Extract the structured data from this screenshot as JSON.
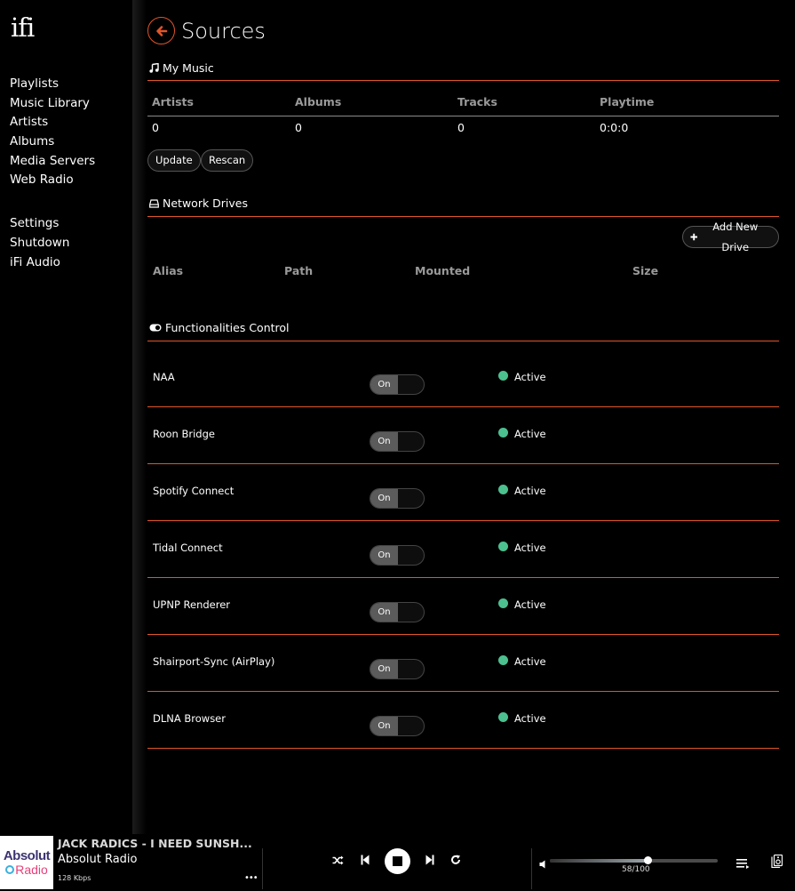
{
  "brand": {
    "logo": "ifi"
  },
  "sidebar": {
    "items": [
      {
        "label": "Playlists"
      },
      {
        "label": "Music Library"
      },
      {
        "label": "Artists"
      },
      {
        "label": "Albums"
      },
      {
        "label": "Media Servers"
      },
      {
        "label": "Web Radio"
      }
    ],
    "secondary_items": [
      {
        "label": "Settings"
      },
      {
        "label": "Shutdown"
      },
      {
        "label": "iFi Audio"
      }
    ]
  },
  "header": {
    "title": "Sources",
    "back_icon": "arrow-left-circle-icon"
  },
  "my_music": {
    "title": "My Music",
    "icon": "music-note-icon",
    "columns": [
      "Artists",
      "Albums",
      "Tracks",
      "Playtime"
    ],
    "values": [
      "0",
      "0",
      "0",
      "0:0:0"
    ],
    "buttons": {
      "update": "Update",
      "rescan": "Rescan"
    }
  },
  "network_drives": {
    "title": "Network Drives",
    "icon": "hard-drive-icon",
    "add_button": "Add New Drive",
    "columns": [
      "Alias",
      "Path",
      "Mounted",
      "Size"
    ]
  },
  "functionalities": {
    "title": "Functionalities Control",
    "icon": "toggle-icon",
    "accent": "#e0552a",
    "active_color": "#4cc08f",
    "rows": [
      {
        "name": "NAA",
        "toggle": "On",
        "status": "Active"
      },
      {
        "name": "Roon Bridge",
        "toggle": "On",
        "status": "Active"
      },
      {
        "name": "Spotify Connect",
        "toggle": "On",
        "status": "Active"
      },
      {
        "name": "Tidal Connect",
        "toggle": "On",
        "status": "Active"
      },
      {
        "name": "UPNP Renderer",
        "toggle": "On",
        "status": "Active"
      },
      {
        "name": "Shairport-Sync (AirPlay)",
        "toggle": "On",
        "status": "Active"
      },
      {
        "name": "DLNA Browser",
        "toggle": "On",
        "status": "Active"
      }
    ]
  },
  "player": {
    "art_line1": "Absolut",
    "art_line2": "Radio",
    "track": "JACK RADICS - I NEED SUNSH...",
    "station": "Absolut Radio",
    "bitrate": "128 Kbps",
    "more": "•••",
    "volume": 58,
    "volume_max": 100,
    "volume_label": "58/100"
  }
}
